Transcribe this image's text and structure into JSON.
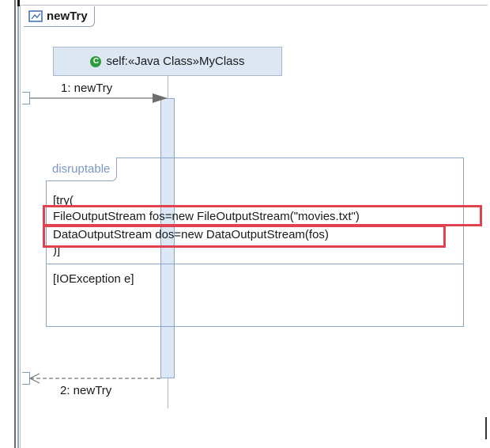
{
  "diagram": {
    "tab_title": "newTry",
    "tab_icon": "sequence-diagram-icon"
  },
  "lifeline": {
    "icon_letter": "C",
    "label": "self:«Java Class»MyClass",
    "icon_color": "#2e9a3e"
  },
  "messages": {
    "call_label": "1: newTry",
    "return_label": "2: newTry"
  },
  "fragment": {
    "operator": "disruptable",
    "guard_lines": [
      "[try(",
      "FileOutputStream fos=new FileOutputStream(\"movies.txt\")",
      "DataOutputStream dos=new DataOutputStream(fos)",
      ")]"
    ],
    "second_guard": "[IOException e]"
  },
  "colors": {
    "highlight": "#e0434f",
    "lifeline_fill": "#dde7f4",
    "frame_border": "#8ea6c6"
  }
}
